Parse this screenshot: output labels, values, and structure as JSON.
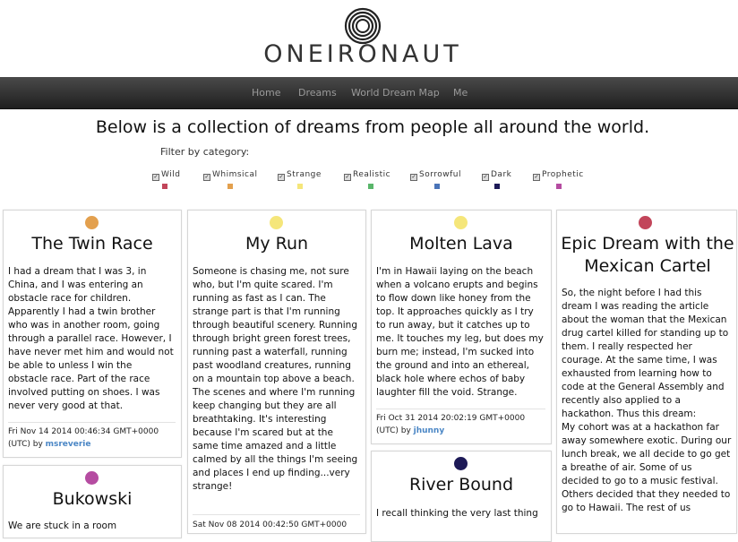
{
  "header": {
    "brand": "ONEIRONAUT",
    "logo_icon": "concentric-rings-icon"
  },
  "nav": {
    "items": [
      {
        "label": "Home"
      },
      {
        "label": "Dreams"
      },
      {
        "label": "World Dream Map"
      },
      {
        "label": "Me"
      }
    ]
  },
  "main": {
    "headline": "Below is a collection of dreams from people all around the world.",
    "filter_label": "Filter by category:",
    "categories": [
      {
        "label": "Wild",
        "color": "#c2455a",
        "checked": true
      },
      {
        "label": "Whimsical",
        "color": "#e3a04e",
        "checked": true
      },
      {
        "label": "Strange",
        "color": "#f5e67a",
        "checked": true
      },
      {
        "label": "Realistic",
        "color": "#59b66a",
        "checked": true
      },
      {
        "label": "Sorrowful",
        "color": "#4a74b8",
        "checked": true
      },
      {
        "label": "Dark",
        "color": "#1d1a57",
        "checked": true
      },
      {
        "label": "Prophetic",
        "color": "#b54ca1",
        "checked": true
      }
    ]
  },
  "cards": [
    {
      "title": "The Twin Race",
      "dot_color": "#e3a04e",
      "body": "I had a dream that I was 3, in China, and I was entering an obstacle race for children. Apparently I had a twin brother who was in another room, going through a parallel race. However, I have never met him and would not be able to unless I win the obstacle race. Part of the race involved putting on shoes. I was never very good at that.",
      "date": "Fri Nov 14 2014 00:46:34 GMT+0000",
      "by": "(UTC) by ",
      "author": "msreverie"
    },
    {
      "title": "My Run",
      "dot_color": "#f5e67a",
      "body": "Someone is chasing me, not sure who, but I'm quite scared. I'm running as fast as I can. The strange part is that I'm running through beautiful scenery. Running through bright green forest trees, running past a waterfall, running past woodland creatures, running on a mountain top above a beach. The scenes and where I'm running keep changing but they are all breathtaking. It's interesting because I'm scared but at the same time amazed and a little calmed by all the things I'm seeing and places I end up finding...very strange!",
      "date": "Sat Nov 08 2014 00:42:50 GMT+0000",
      "by": "",
      "author": ""
    },
    {
      "title": "Molten Lava",
      "dot_color": "#f5e67a",
      "body": "I'm in Hawaii laying on the beach when a volcano erupts and begins to flow down like honey from the top. It approaches quickly as I try to run away, but it catches up to me. It touches my leg, but does my burn me; instead, I'm sucked into the ground and into an ethereal, black hole where echos of baby laughter fill the void. Strange.",
      "date": "Fri Oct 31 2014 20:02:19 GMT+0000",
      "by": "(UTC) by ",
      "author": "jhunny"
    },
    {
      "title": "Epic Dream with the Mexican Cartel",
      "dot_color": "#c2455a",
      "body": "So, the night before I had this dream I was reading the article about the woman that the Mexican drug cartel killed for standing up to them. I really respected her courage. At the same time, I was exhausted from learning how to code at the General Assembly and recently also applied to a hackathon. Thus this dream:",
      "body2": "My cohort was at a hackathon far away somewhere exotic. During our lunch break, we all decide to go get a breathe of air. Some of us decided to go to a music festival. Others decided that they needed to go to Hawaii. The rest of us"
    },
    {
      "title": "Bukowski",
      "dot_color": "#b54ca1",
      "body": "We are stuck in a room"
    },
    {
      "title": "River Bound",
      "dot_color": "#1d1a57",
      "body": "I recall thinking the very last thing"
    }
  ]
}
